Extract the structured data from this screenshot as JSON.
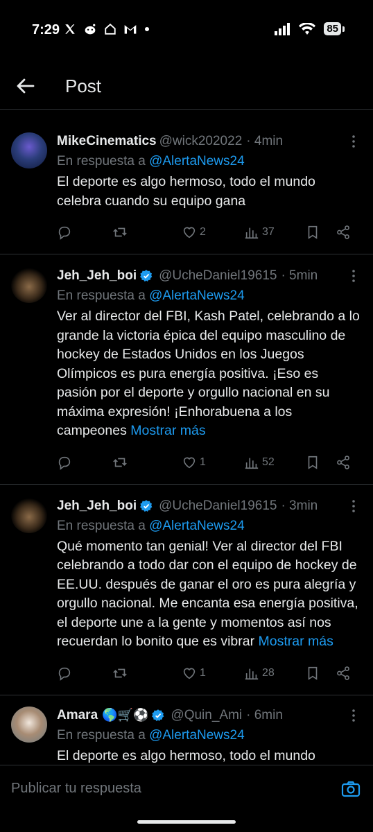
{
  "status_bar": {
    "time": "7:29",
    "battery": "85"
  },
  "header": {
    "title": "Post"
  },
  "posts": [
    {
      "name": "MikeCinematics",
      "verified": false,
      "emoji": "",
      "handle": "@wick202022",
      "time": "· 4min",
      "reply_prefix": "En respuesta a",
      "reply_handle": "@AlertaNews24",
      "text": "El deporte es algo hermoso, todo el mundo celebra cuando su equipo gana",
      "show_more": "",
      "likes": "2",
      "views": "37"
    },
    {
      "name": "Jeh_Jeh_boi",
      "verified": true,
      "emoji": "",
      "handle": "@UcheDaniel19615",
      "time": "· 5min",
      "reply_prefix": "En respuesta a",
      "reply_handle": "@AlertaNews24",
      "text": "Ver al director del FBI, Kash Patel, celebrando a lo grande la victoria épica del equipo masculino de hockey de Estados Unidos en los Juegos Olímpicos es pura energía positiva. ¡Eso es pasión por el deporte y orgullo nacional en su máxima expresión! ¡Enhorabuena a los campeones",
      "show_more": "Mostrar más",
      "likes": "1",
      "views": "52"
    },
    {
      "name": "Jeh_Jeh_boi",
      "verified": true,
      "emoji": "",
      "handle": "@UcheDaniel19615",
      "time": "· 3min",
      "reply_prefix": "En respuesta a",
      "reply_handle": "@AlertaNews24",
      "text": "Qué momento tan genial! Ver al director del FBI celebrando a todo dar con el equipo de hockey de EE.UU. después de ganar el oro es pura alegría y orgullo nacional. Me encanta esa energía positiva, el deporte une a la gente y momentos así nos recuerdan lo bonito que es vibrar",
      "show_more": "Mostrar más",
      "likes": "1",
      "views": "28"
    },
    {
      "name": "Amara",
      "verified": true,
      "emoji": "🌎🛒⚽",
      "handle": "@Quin_Ami",
      "time": "· 6min",
      "reply_prefix": "En respuesta a",
      "reply_handle": "@AlertaNews24",
      "text": "El deporte es algo hermoso, todo el mundo celebra cuando su equipo gana",
      "show_more": "",
      "likes": "",
      "views": ""
    }
  ],
  "compose": {
    "placeholder": "Publicar tu respuesta"
  },
  "colors": {
    "accent": "#1d9bf0",
    "muted": "#71767b",
    "text": "#e7e9ea",
    "divider": "#2f3336"
  }
}
